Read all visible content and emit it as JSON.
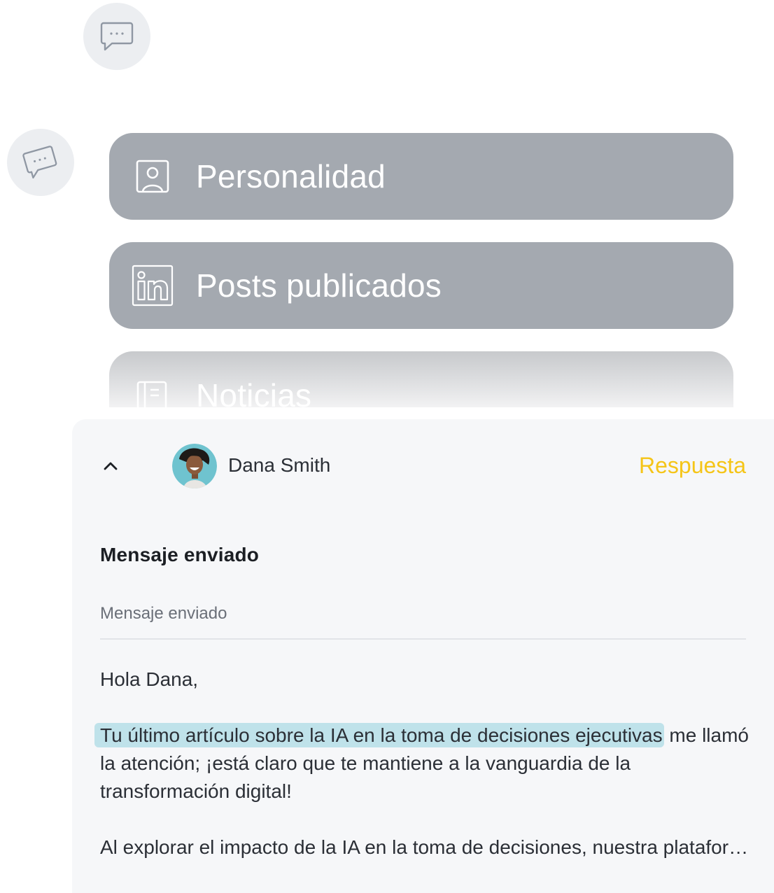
{
  "channels": [
    {
      "label": "Personalidad",
      "icon": "profile-card-icon"
    },
    {
      "label": "Posts publicados",
      "icon": "linkedin-icon"
    },
    {
      "label": "Noticias",
      "icon": "news-icon"
    }
  ],
  "message_card": {
    "contact_name": "Dana Smith",
    "reply_label": "Respuesta",
    "section_title": "Mensaje enviado",
    "subject": "Mensaje enviado",
    "greeting": "Hola Dana,",
    "highlight": "Tu último artículo sobre la IA en la toma de decisiones ejecutivas",
    "paragraph1_rest": " me llamó la atención; ¡está claro que te mantiene a la vanguardia de la transformación digital!",
    "paragraph2": "Al explorar el impacto de la IA en la toma de decisiones, nuestra plataforma…"
  },
  "colors": {
    "pill_bg": "#a4a9b0",
    "accent": "#f5c518",
    "highlight": "#bfe2ea"
  }
}
